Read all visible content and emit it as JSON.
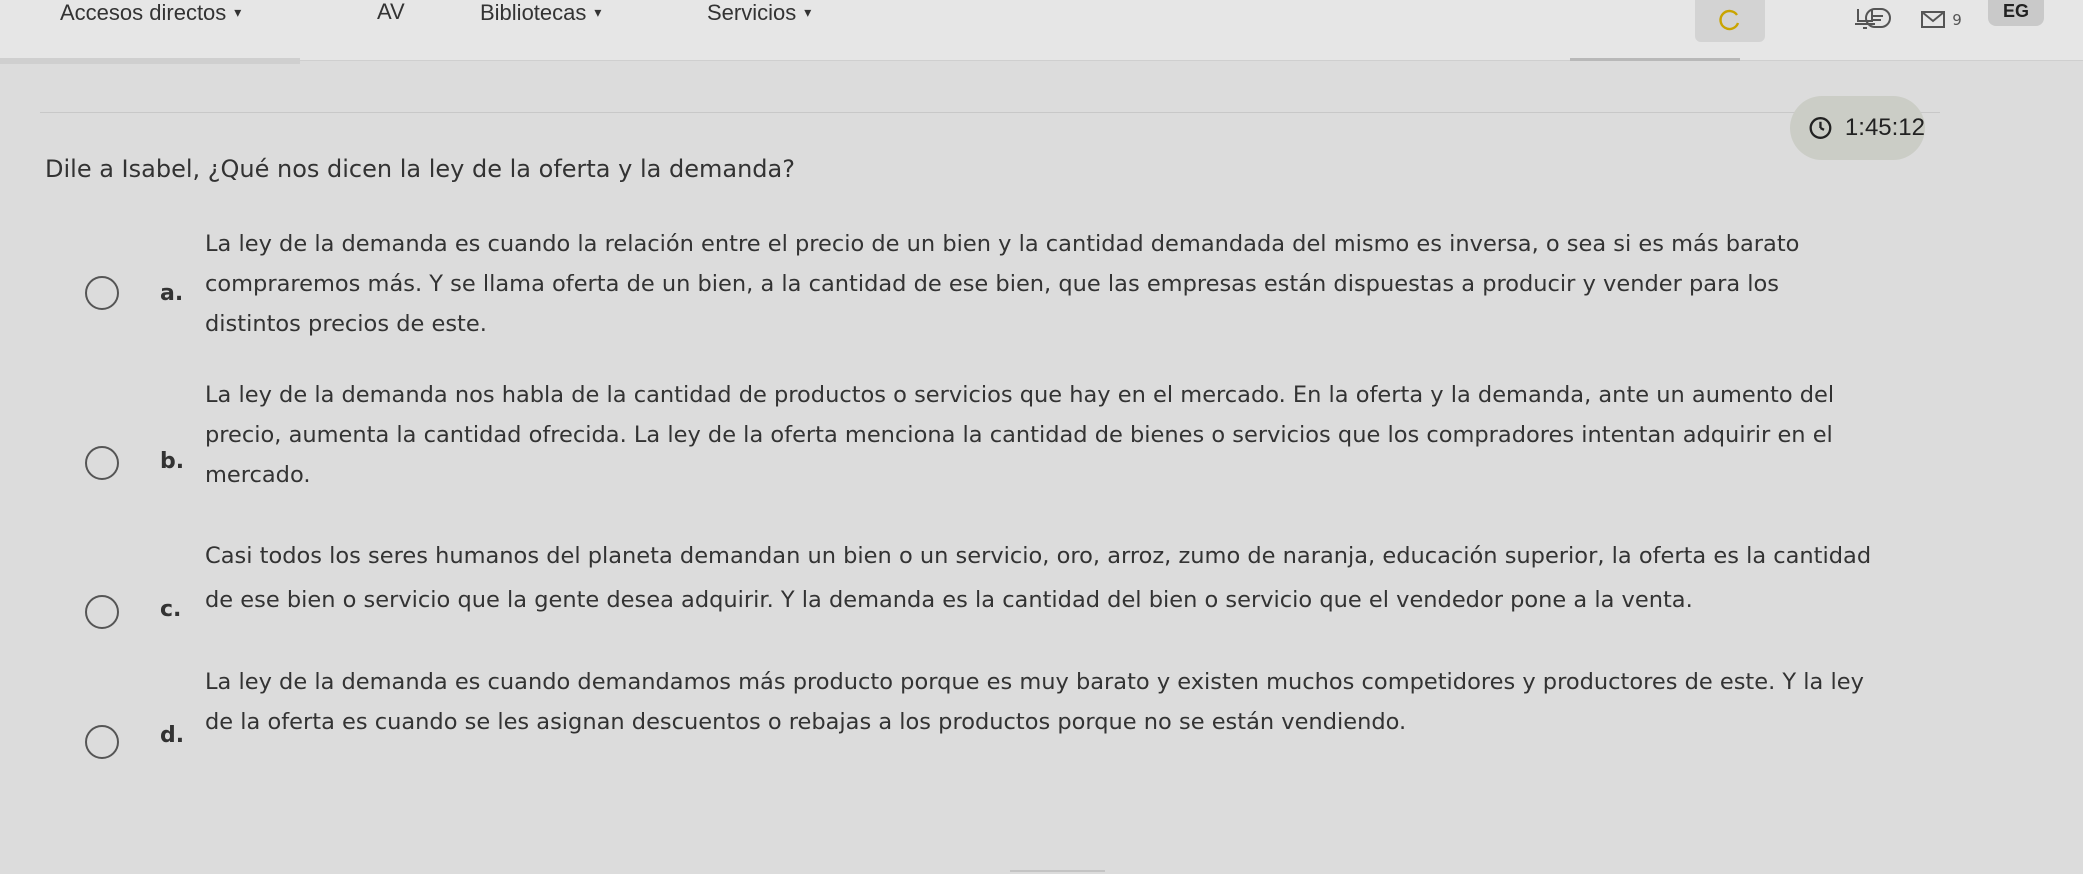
{
  "nav": {
    "accesos": "Accesos directos",
    "av": "AV",
    "bibliotecas": "Bibliotecas",
    "servicios": "Servicios",
    "caret": "▾",
    "badge_count": "9",
    "avatar_initials": "EG"
  },
  "timer": {
    "value": "1:45:12"
  },
  "question": "Dile a Isabel, ¿Qué nos dicen la ley de la oferta y la demanda?",
  "options": [
    {
      "letter": "a.",
      "lines": [
        "La ley de la demanda es cuando la relación entre el precio de un bien y la cantidad demandada del mismo es inversa, o sea si es más barato",
        "compraremos más. Y se llama oferta de un bien, a la cantidad de ese bien, que las empresas están dispuestas a producir y vender para los",
        "distintos precios de este."
      ]
    },
    {
      "letter": "b.",
      "lines": [
        "La ley de la demanda nos habla de la cantidad de productos o servicios que hay en el mercado. En la oferta y la demanda, ante un aumento del",
        "precio, aumenta la cantidad ofrecida. La ley de la oferta menciona la cantidad de bienes o servicios que los compradores intentan adquirir en el",
        "mercado."
      ]
    },
    {
      "letter": "c.",
      "lines": [
        "Casi todos los seres humanos del planeta demandan un bien o un servicio, oro, arroz, zumo de naranja, educación superior, la oferta es la cantidad",
        "de ese bien o servicio que la gente desea adquirir. Y la demanda es la cantidad del bien o servicio que el vendedor pone a la venta."
      ]
    },
    {
      "letter": "d.",
      "lines": [
        "La ley de la demanda es cuando demandamos más producto porque es muy barato y existen muchos competidores y productores de este. Y la ley",
        "de la oferta es cuando se les asignan descuentos o rebajas a los productos porque no se están vendiendo."
      ]
    }
  ],
  "colors": {
    "background": "#dcdcdc",
    "timer_bg": "#cbcdc6",
    "text": "#333333"
  }
}
